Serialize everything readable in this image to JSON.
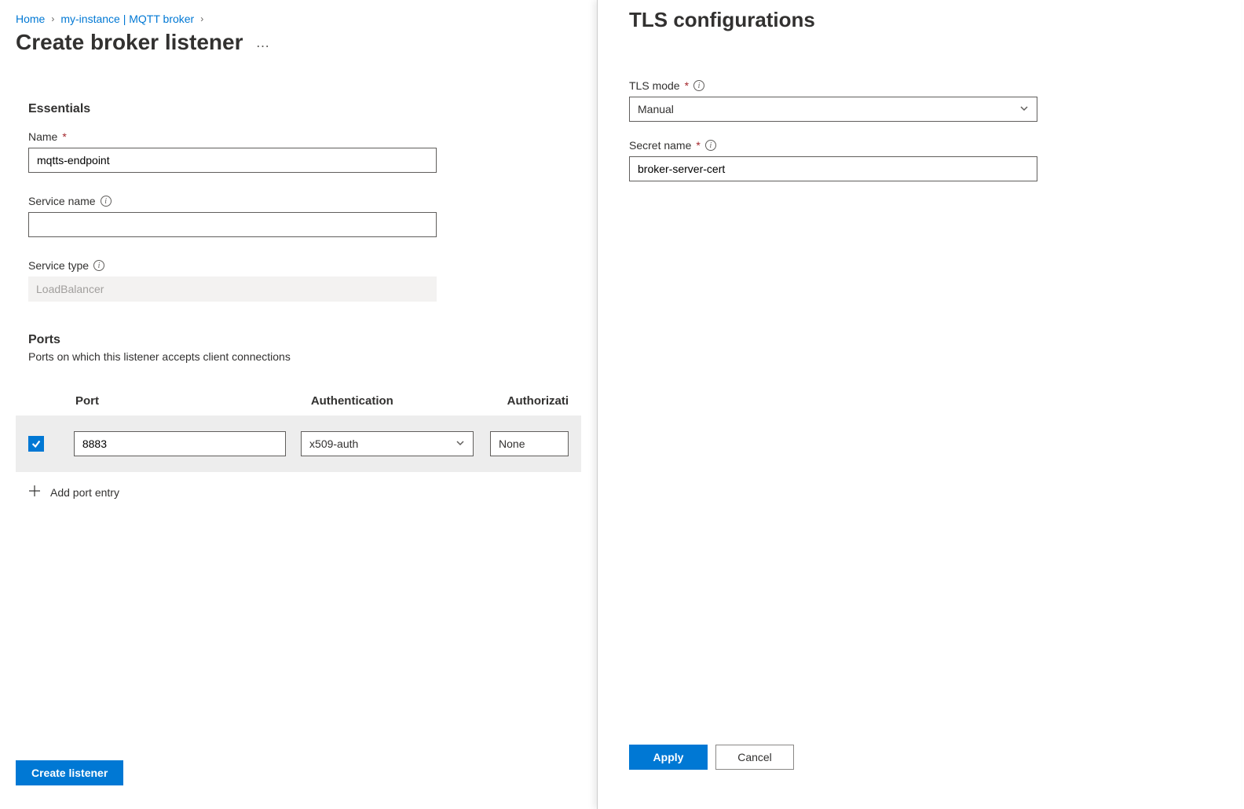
{
  "breadcrumb": {
    "home": "Home",
    "instance": "my-instance | MQTT broker"
  },
  "page_title": "Create broker listener",
  "essentials": {
    "heading": "Essentials",
    "name_label": "Name",
    "name_value": "mqtts-endpoint",
    "service_name_label": "Service name",
    "service_name_value": "",
    "service_type_label": "Service type",
    "service_type_value": "LoadBalancer"
  },
  "ports": {
    "heading": "Ports",
    "description": "Ports on which this listener accepts client connections",
    "columns": {
      "port": "Port",
      "auth": "Authentication",
      "authz": "Authorizati"
    },
    "rows": [
      {
        "checked": true,
        "port": "8883",
        "auth": "x509-auth",
        "authz": "None"
      }
    ],
    "add_label": "Add port entry"
  },
  "footer": {
    "create": "Create listener"
  },
  "panel": {
    "title": "TLS configurations",
    "tls_mode_label": "TLS mode",
    "tls_mode_value": "Manual",
    "secret_name_label": "Secret name",
    "secret_name_value": "broker-server-cert",
    "apply": "Apply",
    "cancel": "Cancel"
  }
}
